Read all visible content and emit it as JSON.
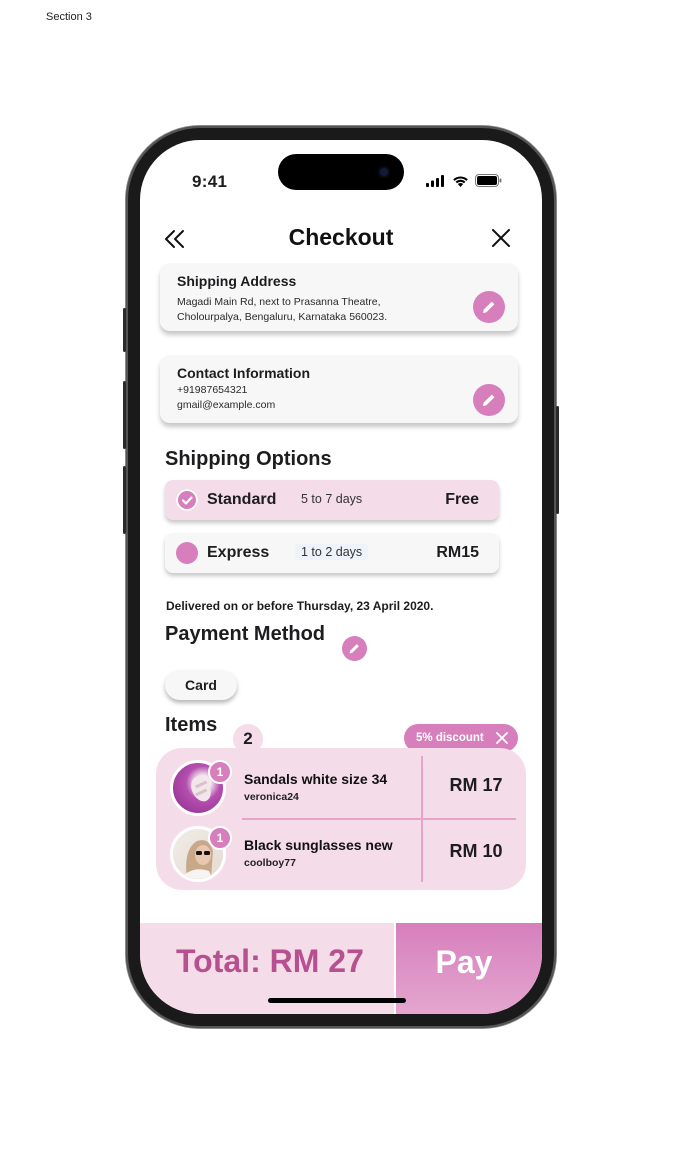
{
  "canvas_label": "Section 3",
  "status_bar": {
    "time": "9:41"
  },
  "header": {
    "title": "Checkout"
  },
  "shipping_address": {
    "title": "Shipping Address",
    "line1": "Magadi Main Rd, next to Prasanna Theatre,",
    "line2": "Cholourpalya, Bengaluru, Karnataka 560023."
  },
  "contact_info": {
    "title": "Contact Information",
    "phone": "+91987654321",
    "email": "gmail@example.com"
  },
  "shipping_options": {
    "title": "Shipping Options",
    "options": [
      {
        "name": "Standard",
        "days": "5 to 7 days",
        "price": "Free",
        "selected": true
      },
      {
        "name": "Express",
        "days": "1 to 2 days",
        "price": "RM15",
        "selected": false
      }
    ],
    "delivery_note": "Delivered on or before Thursday, 23 April 2020."
  },
  "payment": {
    "title": "Payment Method",
    "method": "Card"
  },
  "items": {
    "title": "Items",
    "count": "2",
    "discount": "5% discount",
    "list": [
      {
        "name": "Sandals white size 34",
        "user": "veronica24",
        "price": "RM 17",
        "qty": "1"
      },
      {
        "name": "Black sunglasses new",
        "user": "coolboy77",
        "price": "RM 10",
        "qty": "1"
      }
    ]
  },
  "footer": {
    "total": "Total: RM 27",
    "pay_label": "Pay"
  },
  "colors": {
    "accent": "#d67fbc",
    "accent_light": "#f5dce9",
    "total_text": "#b6508f"
  },
  "icons": [
    "back-chevrons-icon",
    "close-icon",
    "edit-pencil-icon",
    "check-icon",
    "signal-icon",
    "wifi-icon",
    "battery-icon"
  ]
}
